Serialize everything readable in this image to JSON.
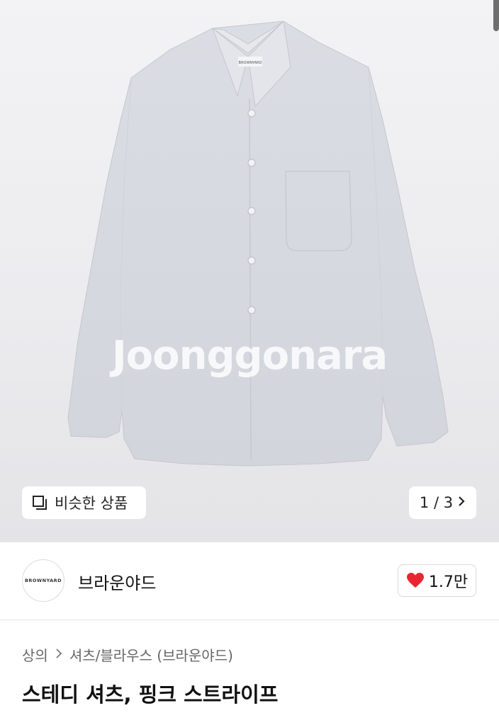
{
  "product_image": {
    "watermark": "Joonggonara",
    "label_text": "BROWNYARD"
  },
  "similar_button": {
    "label": "비슷한 상품",
    "icon": "similar-items-icon"
  },
  "pager": {
    "label": "1 / 3",
    "icon": "chevron-right-icon"
  },
  "seller": {
    "logo_text": "BROWNYARD",
    "name": "브라운야드"
  },
  "likes": {
    "count": "1.7만",
    "icon": "heart-icon",
    "color": "#e8262f"
  },
  "breadcrumb": {
    "level1": "상의",
    "level2": "셔츠/블라우스 (브라운야드)"
  },
  "product": {
    "title": "스테디 셔츠, 핑크 스트라이프"
  }
}
